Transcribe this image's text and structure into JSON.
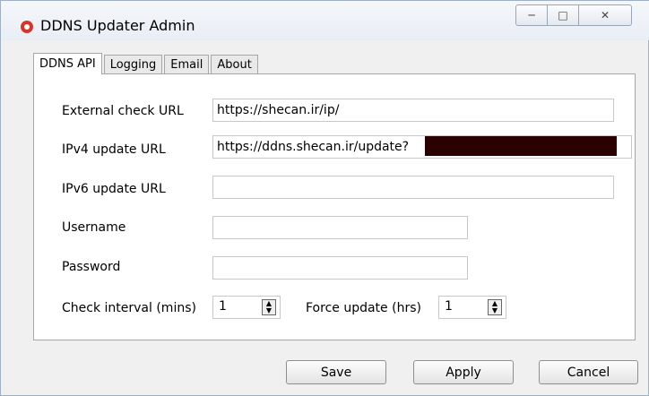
{
  "window": {
    "title": "DDNS Updater Admin",
    "controls": {
      "minimize": "─",
      "maximize": "□",
      "close": "✕"
    }
  },
  "tabs": [
    "DDNS API",
    "Logging",
    "Email",
    "About"
  ],
  "form": {
    "external_check": {
      "label": "External check URL",
      "value": "https://shecan.ir/ip/"
    },
    "ipv4": {
      "label": "IPv4 update URL",
      "value": "https://ddns.shecan.ir/update?"
    },
    "ipv6": {
      "label": "IPv6 update URL",
      "value": ""
    },
    "username": {
      "label": "Username",
      "value": ""
    },
    "password": {
      "label": "Password",
      "value": ""
    },
    "check_interval": {
      "label": "Check interval (mins)",
      "value": "1"
    },
    "force_update": {
      "label": "Force update (hrs)",
      "value": "1"
    }
  },
  "buttons": {
    "save": "Save",
    "apply": "Apply",
    "cancel": "Cancel"
  },
  "colors": {
    "app_icon": "#d8342a",
    "redaction": "#2a0000"
  }
}
